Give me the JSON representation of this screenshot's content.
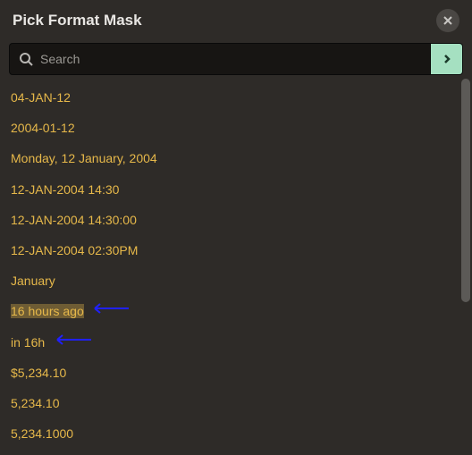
{
  "header": {
    "title": "Pick Format Mask"
  },
  "search": {
    "placeholder": "Search",
    "value": ""
  },
  "list": {
    "items": [
      {
        "label": "04-JAN-12"
      },
      {
        "label": "2004-01-12"
      },
      {
        "label": "Monday, 12 January, 2004"
      },
      {
        "label": "12-JAN-2004 14:30"
      },
      {
        "label": "12-JAN-2004 14:30:00"
      },
      {
        "label": "12-JAN-2004 02:30PM"
      },
      {
        "label": "January"
      },
      {
        "label": "16 hours ago",
        "highlighted": true,
        "arrow": true
      },
      {
        "label": "in 16h",
        "arrow": true
      },
      {
        "label": "$5,234.10"
      },
      {
        "label": "5,234.10"
      },
      {
        "label": "5,234.1000"
      }
    ]
  },
  "annotations": {
    "arrow_color": "#2020ff"
  }
}
